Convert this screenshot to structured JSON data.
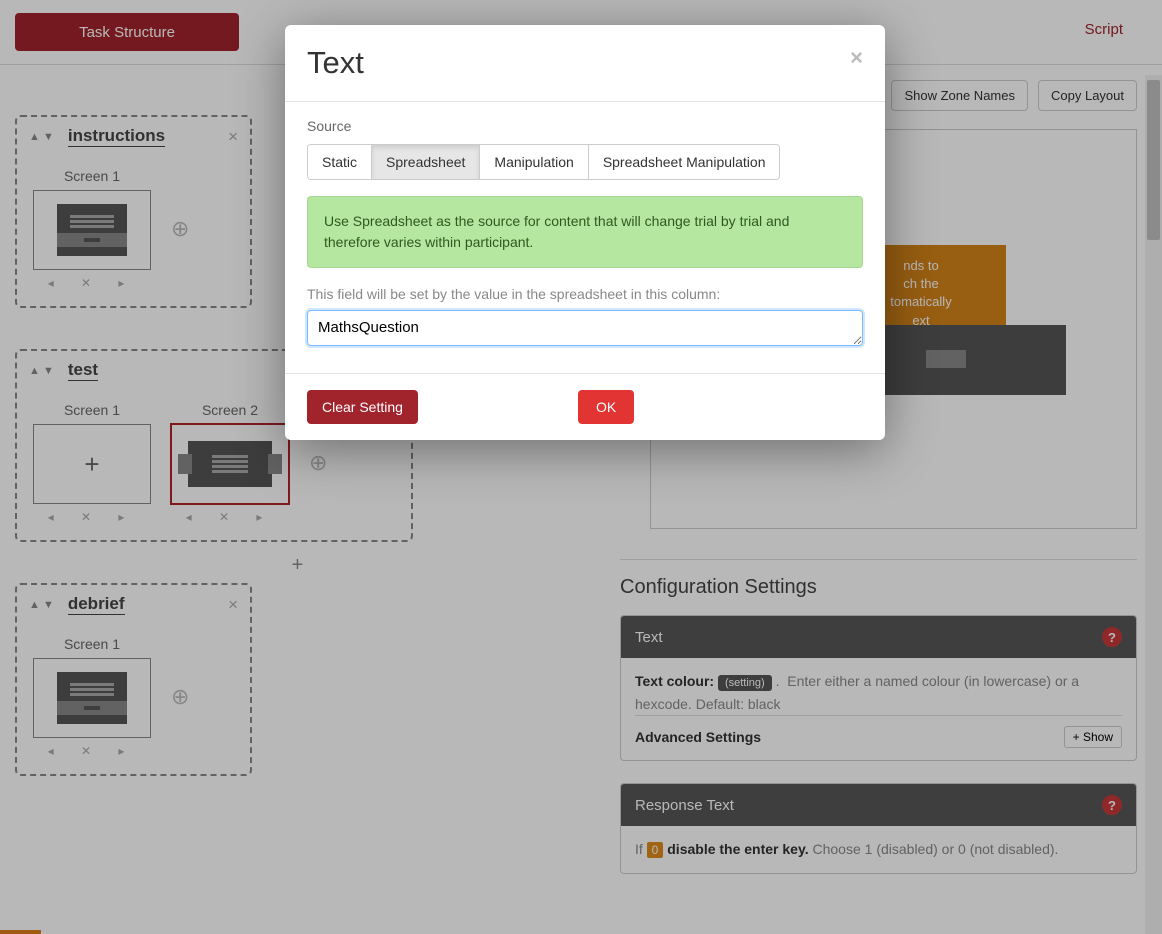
{
  "topbar": {
    "task_structure": "Task Structure",
    "script": "Script"
  },
  "displays": [
    {
      "name": "instructions",
      "screens": [
        {
          "title": "Screen 1",
          "thumb": "lines",
          "selected": false
        }
      ]
    },
    {
      "name": "test",
      "wide": true,
      "screens": [
        {
          "title": "Screen 1",
          "thumb": "plus",
          "selected": false
        },
        {
          "title": "Screen 2",
          "thumb": "complex",
          "selected": true
        }
      ]
    },
    {
      "name": "debrief",
      "screens": [
        {
          "title": "Screen 1",
          "thumb": "lines",
          "selected": false
        }
      ]
    }
  ],
  "right": {
    "show_zone": "Show Zone Names",
    "copy_layout": "Copy Layout",
    "orange_hint": "...nds to ...ch the ...tomatically ...ext",
    "config_h": "Configuration Settings",
    "panels": {
      "text": {
        "title": "Text",
        "colour_label": "Text colour:",
        "setting_tag": "(setting)",
        "colour_hint": "Enter either a named colour (in lowercase) or a hexcode. Default: black",
        "advanced": "Advanced Settings",
        "show": "Show"
      },
      "response": {
        "title": "Response Text",
        "if_label": "If",
        "zero": "0",
        "if_bold": "disable the enter key.",
        "if_hint": "Choose 1 (disabled) or 0 (not disabled)."
      }
    }
  },
  "modal": {
    "title": "Text",
    "source_label": "Source",
    "tabs": {
      "static": "Static",
      "spreadsheet": "Spreadsheet",
      "manipulation": "Manipulation",
      "spreadsheet_manip": "Spreadsheet Manipulation"
    },
    "active_tab": "spreadsheet",
    "alert": "Use Spreadsheet as the source for content that will change trial by trial and therefore varies within participant.",
    "field_label": "This field will be set by the value in the spreadsheet in this column:",
    "input_value": "MathsQuestion",
    "clear": "Clear Setting",
    "ok": "OK"
  }
}
